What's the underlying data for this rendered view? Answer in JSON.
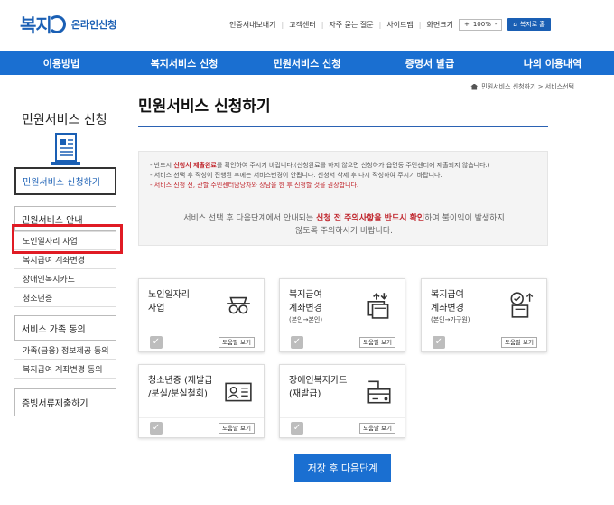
{
  "header": {
    "logo_mark": "복지",
    "logo_text": "온라인신청",
    "util_links": [
      "인증서내보내기",
      "고객센터",
      "자주 묻는 질문",
      "사이트맵"
    ],
    "font_size_label": "화면크기",
    "zoom_plus": "+",
    "zoom_value": "100%",
    "zoom_minus": "-",
    "home_button": "복지로 홈"
  },
  "gnb": [
    "이용방법",
    "복지서비스 신청",
    "민원서비스 신청",
    "증명서 발급",
    "나의 이용내역"
  ],
  "breadcrumb": {
    "path": "민원서비스 신청하기 > 서비스선택"
  },
  "sidebar": {
    "title": "민원서비스 신청",
    "active_item": "민원서비스 신청하기",
    "section_guide": "민원서비스 안내",
    "guide_items": [
      "노인일자리 사업",
      "복지급여 계좌변경",
      "장애인복지카드",
      "청소년증"
    ],
    "section_family": "서비스 가족 동의",
    "family_items": [
      "가족(금융) 정보제공 동의",
      "복지급여 계좌변경 동의"
    ],
    "section_submit": "증빙서류제출하기"
  },
  "main": {
    "page_title": "민원서비스 신청하기",
    "notice": {
      "line1_pre": "반드시 ",
      "line1_em": "신청서 제출완료",
      "line1_post": "를 확인하여 주시기 바랍니다.(신청완료를 하지 않으면 신청하가 읍면동 주민센터에 제출되지 않습니다.)",
      "line2": "서비스 선택 후 작성이 진행된 후에는 서비스변경이 안됩니다. 신청서 삭제 후 다시 작성하여 주시기 바랍니다.",
      "line3": "서비스 신청 전, 관할 주민센터담당자와 상담을 한 후 신청할 것을 권장합니다.",
      "main_pre": "서비스 선택 후 다음단계에서 안내되는 ",
      "main_em": "신청 전 주의사항을 반드시 확인",
      "main_post": "하여 불이익이 발생하지",
      "main_line2": "않도록 주의하시기 바랍니다."
    },
    "cards": [
      {
        "title1": "노인일자리",
        "title2": "사업",
        "sub": "",
        "icon": "elder-glasses-icon",
        "help": "도움말 보기"
      },
      {
        "title1": "복지급여",
        "title2": "계좌변경",
        "sub": "(본인→본인)",
        "icon": "account-change-icon",
        "help": "도움말 보기"
      },
      {
        "title1": "복지급여",
        "title2": "계좌변경",
        "sub": "(본인→가구원)",
        "icon": "family-account-icon",
        "help": "도움말 보기"
      },
      {
        "title1": "청소년증 (재발급",
        "title2": "/분실/분실철회)",
        "sub": "",
        "icon": "id-card-icon",
        "help": "도움말 보기"
      },
      {
        "title1": "장애인복지카드",
        "title2": "(재발급)",
        "sub": "",
        "icon": "welfare-card-icon",
        "help": "도움말 보기"
      }
    ],
    "check_mark": "✓",
    "next_button": "저장 후 다음단계"
  },
  "colors": {
    "primary": "#1a6fd1",
    "highlight": "#e01b24",
    "emphasis": "#c0262d"
  }
}
